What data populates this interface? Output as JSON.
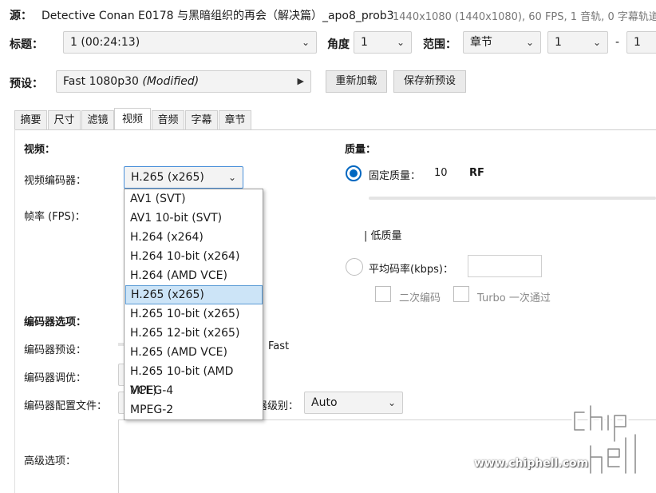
{
  "source": {
    "label": "源：",
    "name": "Detective Conan E0178 与黑暗组织的再会（解决篇）_apo8_prob3",
    "info": "1440x1080 (1440x1080), 60 FPS, 1 音轨, 0 字幕轨道"
  },
  "title_row": {
    "title_label": "标题：",
    "title_value": "1  (00:24:13)",
    "angle_label": "角度",
    "angle_value": "1",
    "range_label": "范围：",
    "range_type": "章节",
    "range_start": "1",
    "range_dash": "-",
    "range_end": "1"
  },
  "preset_row": {
    "label": "预设：",
    "name": "Fast 1080p30",
    "modified": "(Modified)",
    "reload_button": "重新加载",
    "save_button": "保存新预设"
  },
  "tabs": [
    "摘要",
    "尺寸",
    "滤镜",
    "视频",
    "音频",
    "字幕",
    "章节"
  ],
  "active_tab": "视频",
  "video": {
    "section_label": "视频：",
    "encoder_label": "视频编码器：",
    "encoder_value": "H.265 (x265)",
    "fps_label": "帧率 (FPS)：",
    "encoder_options": [
      "AV1 (SVT)",
      "AV1 10-bit (SVT)",
      "H.264 (x264)",
      "H.264 10-bit (x264)",
      "H.264 (AMD VCE)",
      "H.265 (x265)",
      "H.265 10-bit (x265)",
      "H.265 12-bit (x265)",
      "H.265 (AMD VCE)",
      "H.265 10-bit (AMD VCE)",
      "MPEG-4",
      "MPEG-2"
    ]
  },
  "quality": {
    "section_label": "质量：",
    "constant_label": "固定质量：",
    "rf_value": "10",
    "rf_unit": "RF",
    "low_quality_label": "| 低质量",
    "avg_bitrate_label": "平均码率(kbps)：",
    "two_pass_label": "二次编码",
    "turbo_label": "Turbo 一次通过"
  },
  "encoder_options": {
    "section_label": "编码器选项：",
    "preset_label": "编码器预设：",
    "preset_value": "Fast",
    "tune_label": "编码器调优：",
    "profile_label": "编码器配置文件：",
    "level_label": "编码器级别：",
    "level_value": "Auto",
    "advanced_label": "高级选项："
  },
  "watermark": {
    "url": "www.chiphell.com"
  },
  "colors": {
    "accent": "#0067c0",
    "selected_item_bg": "#cce4f7",
    "selected_item_border": "#5b9bd5"
  }
}
